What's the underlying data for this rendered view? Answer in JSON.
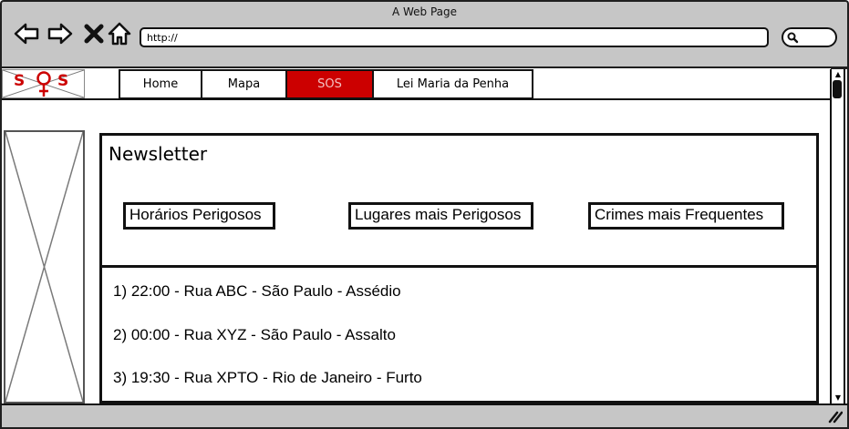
{
  "window": {
    "title": "A Web Page"
  },
  "toolbar": {
    "back_icon": "back-arrow-icon",
    "forward_icon": "forward-arrow-icon",
    "close_icon": "close-icon",
    "home_icon": "home-icon",
    "url": "http://",
    "search_icon": "search-icon"
  },
  "nav": {
    "logo": {
      "letter_left": "S",
      "letter_right": "S",
      "icon": "female-symbol-icon"
    },
    "items": [
      {
        "label": "Home"
      },
      {
        "label": "Mapa"
      },
      {
        "label": "SOS",
        "active": true
      },
      {
        "label": "Lei Maria da Penha"
      }
    ]
  },
  "main": {
    "title": "Newsletter",
    "tabs": [
      {
        "label": "Horários Perigosos"
      },
      {
        "label": "Lugares mais Perigosos"
      },
      {
        "label": "Crimes mais Frequentes"
      }
    ],
    "items": [
      "1) 22:00 - Rua ABC - São Paulo - Assédio",
      "2) 00:00 - Rua XYZ - São Paulo - Assalto",
      "3) 19:30 - Rua XPTO - Rio de Janeiro - Furto"
    ]
  },
  "colors": {
    "active_nav": "#cc0000",
    "logo_red": "#cc0000",
    "chrome": "#c6c6c6"
  }
}
